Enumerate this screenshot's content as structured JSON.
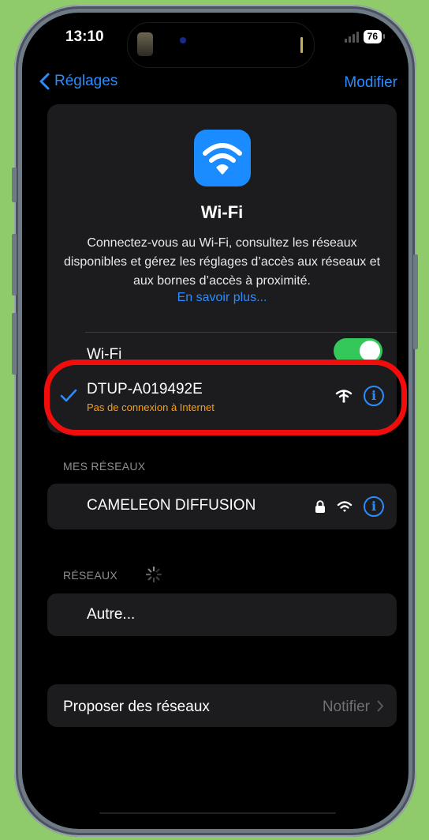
{
  "status_bar": {
    "time": "13:10",
    "battery": "76"
  },
  "nav": {
    "back_label": "Réglages",
    "edit_label": "Modifier"
  },
  "hero": {
    "title": "Wi-Fi",
    "description": "Connectez-vous au Wi-Fi, consultez les réseaux disponibles et gérez les réglages d’accès aux réseaux et aux bornes d’accès à proximité.",
    "link": "En savoir plus..."
  },
  "wifi_toggle": {
    "label": "Wi-Fi",
    "enabled": true
  },
  "connected_network": {
    "name": "DTUP-A019492E",
    "status": "Pas de connexion à Internet",
    "info_icon": "i"
  },
  "my_networks": {
    "header": "MES RÉSEAUX",
    "items": [
      {
        "name": "CAMELEON DIFFUSION",
        "info_icon": "i"
      }
    ]
  },
  "networks": {
    "header": "RÉSEAUX",
    "other_label": "Autre..."
  },
  "propose": {
    "label": "Proposer des réseaux",
    "value": "Notifier"
  },
  "colors": {
    "accent": "#2a8cff",
    "toggle_on": "#34c759",
    "warning": "#ff9f0a",
    "highlight": "#f20d0d",
    "background": "#8fcb6b"
  }
}
